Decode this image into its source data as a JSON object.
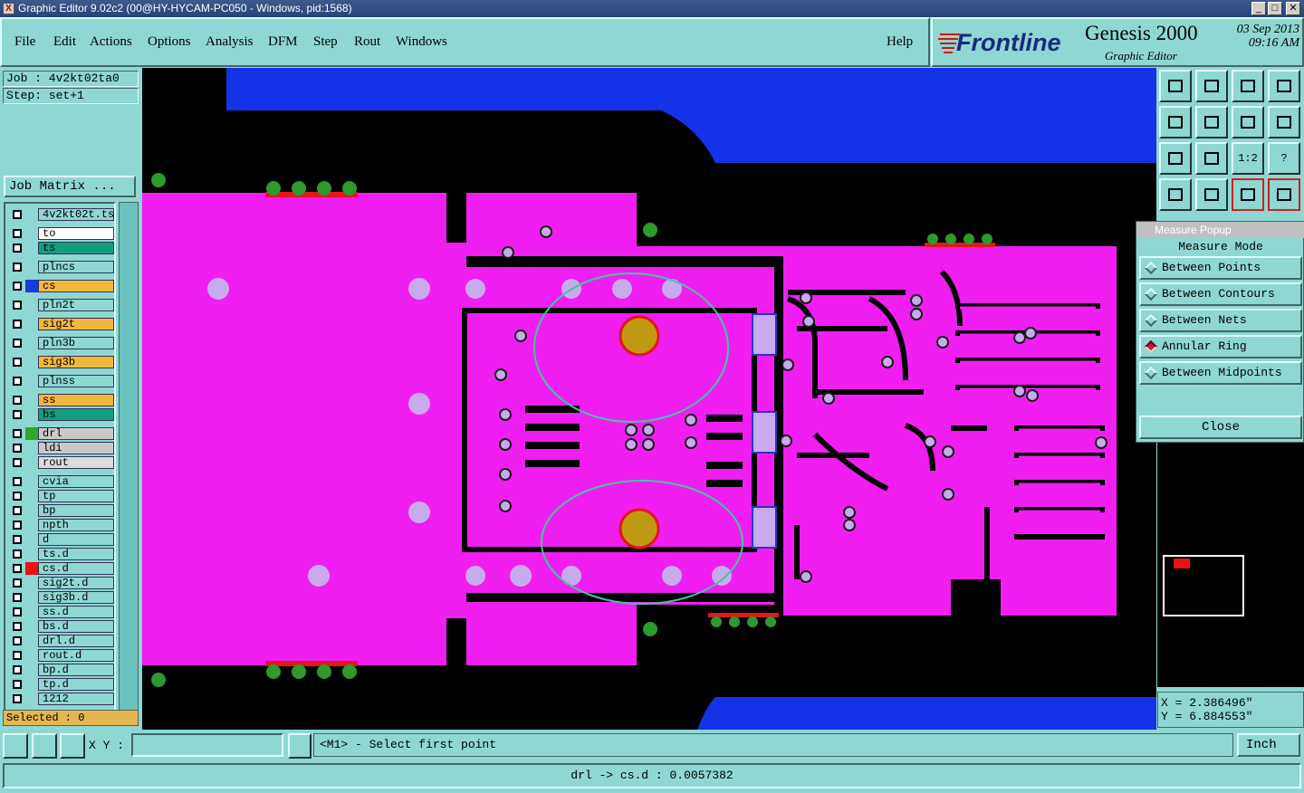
{
  "window": {
    "title": "Graphic Editor 9.02c2 (00@HY-HYCAM-PC050 - Windows, pid:1568)",
    "buttons": [
      "_",
      "□",
      "✕"
    ]
  },
  "menu": [
    "File",
    "Edit",
    "Actions",
    "Options",
    "Analysis",
    "DFM",
    "Step",
    "Rout",
    "Windows"
  ],
  "help_label": "Help",
  "brand": {
    "logo_text": "Frontline",
    "product": "Genesis 2000",
    "subtitle": "Graphic Editor",
    "date": "03  Sep  2013",
    "time": "09:16  AM"
  },
  "job": {
    "job_line": "Job : 4v2kt02ta0",
    "step_line": "Step: set+1",
    "matrix_button": "Job Matrix ..."
  },
  "layers": [
    {
      "name": "4v2kt02t.ts",
      "bg": "#8ed7d2",
      "swatch": ""
    },
    {
      "name": "to",
      "bg": "#ffffff",
      "swatch": ""
    },
    {
      "name": "ts",
      "bg": "#129e7c",
      "swatch": ""
    },
    {
      "name": "plncs",
      "bg": "#8ed7d2",
      "swatch": ""
    },
    {
      "name": "cs",
      "bg": "#f3b63c",
      "swatch": "#1a3adf"
    },
    {
      "name": "pln2t",
      "bg": "#8ed7d2",
      "swatch": ""
    },
    {
      "name": "sig2t",
      "bg": "#f3b63c",
      "swatch": ""
    },
    {
      "name": "pln3b",
      "bg": "#8ed7d2",
      "swatch": ""
    },
    {
      "name": "sig3b",
      "bg": "#f3b63c",
      "swatch": ""
    },
    {
      "name": "plnss",
      "bg": "#8ed7d2",
      "swatch": ""
    },
    {
      "name": "ss",
      "bg": "#f3b63c",
      "swatch": ""
    },
    {
      "name": "bs",
      "bg": "#129e7c",
      "swatch": ""
    },
    {
      "name": "drl",
      "bg": "#c9c9c9",
      "swatch": "#2fa82f"
    },
    {
      "name": "ldi",
      "bg": "#c9c9c9",
      "swatch": ""
    },
    {
      "name": "rout",
      "bg": "#dcdcdc",
      "swatch": ""
    },
    {
      "name": "cvia",
      "bg": "#8ed7d2",
      "swatch": ""
    },
    {
      "name": "tp",
      "bg": "#8ed7d2",
      "swatch": ""
    },
    {
      "name": "bp",
      "bg": "#8ed7d2",
      "swatch": ""
    },
    {
      "name": "npth",
      "bg": "#8ed7d2",
      "swatch": ""
    },
    {
      "name": "d",
      "bg": "#8ed7d2",
      "swatch": ""
    },
    {
      "name": "ts.d",
      "bg": "#8ed7d2",
      "swatch": ""
    },
    {
      "name": "cs.d",
      "bg": "#8ed7d2",
      "swatch": "#ee1111"
    },
    {
      "name": "sig2t.d",
      "bg": "#8ed7d2",
      "swatch": ""
    },
    {
      "name": "sig3b.d",
      "bg": "#8ed7d2",
      "swatch": ""
    },
    {
      "name": "ss.d",
      "bg": "#8ed7d2",
      "swatch": ""
    },
    {
      "name": "bs.d",
      "bg": "#8ed7d2",
      "swatch": ""
    },
    {
      "name": "drl.d",
      "bg": "#8ed7d2",
      "swatch": ""
    },
    {
      "name": "rout.d",
      "bg": "#8ed7d2",
      "swatch": ""
    },
    {
      "name": "bp.d",
      "bg": "#8ed7d2",
      "swatch": ""
    },
    {
      "name": "tp.d",
      "bg": "#8ed7d2",
      "swatch": ""
    },
    {
      "name": "1212",
      "bg": "#8ed7d2",
      "swatch": ""
    }
  ],
  "selected_text": "Selected : 0",
  "measure": {
    "title": "Measure Popup",
    "mode_label": "Measure Mode",
    "options": [
      "Between Points",
      "Between Contours",
      "Between Nets",
      "Annular Ring",
      "Between Midpoints"
    ],
    "active": "Annular Ring",
    "close_label": "Close"
  },
  "toolbar_icons": [
    "page-up-icon",
    "page-down-icon",
    "home-icon",
    "split-view-icon",
    "pan-left-icon",
    "pan-right-icon",
    "mirror-icon",
    "route-icon",
    "zoom-fit-icon",
    "zoom-center-icon",
    "scale-icon",
    "help-icon",
    "tools-icon",
    "snap-icon",
    "net-a-icon",
    "net-b-icon"
  ],
  "toolbar_labels": {
    "scale": "1:2",
    "help": "?"
  },
  "coords": {
    "x": "X = 2.386496\"",
    "y": "Y = 6.884553\""
  },
  "bottom": {
    "xy_label": "X Y :",
    "xy_value": "",
    "prompt": "<M1> - Select first point",
    "unit": "Inch"
  },
  "status_line": "drl -> cs.d : 0.0057382",
  "colors": {
    "copper": "#f01ef0",
    "board_black": "#000000",
    "blue_area": "#1432e6",
    "pad_green": "#2c9a2c",
    "drill_gold": "#c09a14",
    "via_lilac": "#c8aaf0",
    "measure_ellipse": "#3cc8a0"
  }
}
